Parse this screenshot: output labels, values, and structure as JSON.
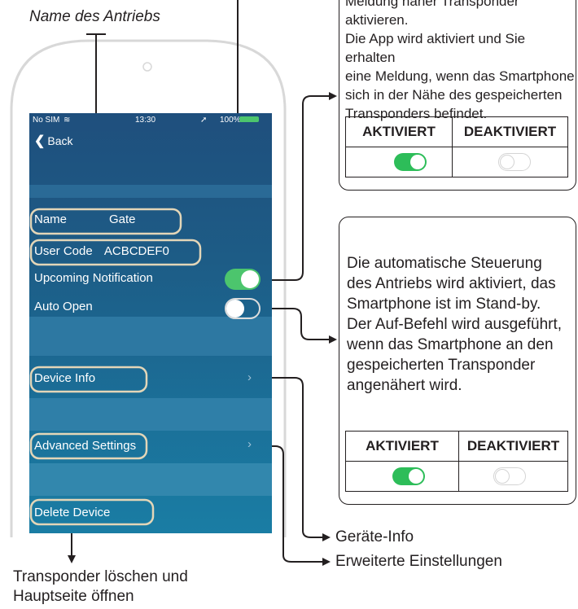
{
  "annotations": {
    "name_label": "Name des Antriebs",
    "delete_label": [
      "Transponder löschen und",
      "Hauptseite öffnen"
    ],
    "device_info_label": "Geräte-Info",
    "advanced_label": "Erweiterte Einstellungen"
  },
  "notification_box": {
    "lines": [
      "Meldung näher Transponder",
      "aktivieren.",
      "Die App wird aktiviert und Sie erhalten",
      "eine Meldung, wenn das Smartphone",
      "sich in der Nähe des gespeicherten",
      "Transponders befindet."
    ],
    "col_on": "AKTIVIERT",
    "col_off": "DEAKTIVIERT"
  },
  "autoopen_box": {
    "lines": [
      "Die automatische Steuerung",
      "des Antriebs wird aktiviert, das",
      "Smartphone ist im Stand-by.",
      "Der Auf-Befehl wird ausgeführt,",
      "wenn das Smartphone an den",
      "gespeicherten Transponder",
      "angenähert wird."
    ],
    "col_on": "AKTIVIERT",
    "col_off": "DEAKTIVIERT"
  },
  "phone": {
    "status": {
      "carrier": "No SIM",
      "time": "13:30",
      "battery": "100%"
    },
    "nav": {
      "back": "Back"
    },
    "name_row": {
      "label": "Name",
      "value": "Gate"
    },
    "usercode_row": {
      "label": "User Code",
      "value": "ACBCDEF0"
    },
    "upcoming_label": "Upcoming Notification",
    "upcoming_state": "on",
    "autoopen_label": "Auto Open",
    "autoopen_state": "off",
    "device_info": "Device Info",
    "advanced_settings": "Advanced Settings",
    "delete_device": "Delete Device"
  },
  "colors": {
    "screen_top": "#1f4f7d",
    "screen_bottom": "#1a7da4",
    "toggle_on": "#4cc56d"
  }
}
